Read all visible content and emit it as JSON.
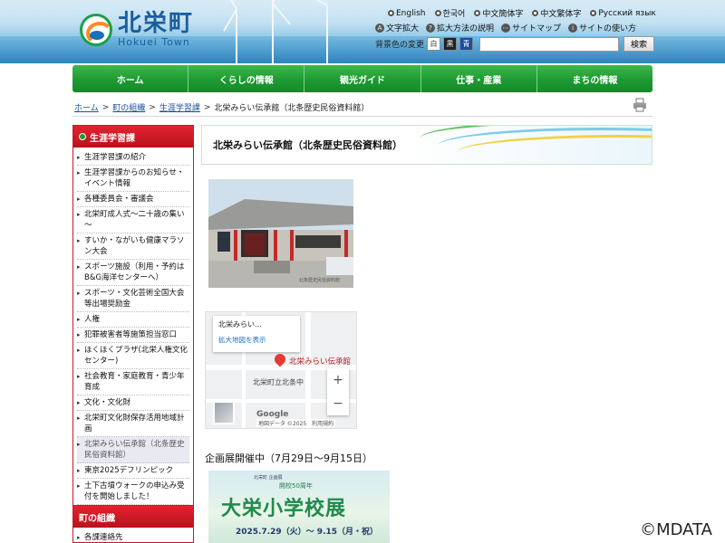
{
  "header": {
    "logo_title": "北栄町",
    "logo_sub": "Hokuei Town",
    "languages": [
      "English",
      "한국어",
      "中文簡体字",
      "中文繁体字",
      "Русский язык"
    ],
    "util": {
      "text_size": "文字拡大",
      "zoom_help": "拡大方法の説明",
      "sitemap": "サイトマップ",
      "usage": "サイトの使い方"
    },
    "bg_color_label": "背景色の変更",
    "bg_options": [
      "白",
      "黒",
      "青"
    ],
    "search_placeholder": "",
    "search_button": "検索"
  },
  "gnav": [
    "ホーム",
    "くらしの情報",
    "観光ガイド",
    "仕事・産業",
    "まちの情報"
  ],
  "breadcrumb": {
    "items": [
      "ホーム",
      "町の組織",
      "生涯学習課"
    ],
    "sep": ">",
    "current": "北栄みらい伝承館（北条歴史民俗資料館）"
  },
  "sidebar": {
    "title": "生涯学習課",
    "items": [
      "生涯学習課の紹介",
      "生涯学習課からのお知らせ・イベント情報",
      "各種委員会・審議会",
      "北栄町成人式～二十歳の集い～",
      "すいか・ながいも健康マラソン大会",
      "スポーツ施設（利用・予約はB&G海洋センターへ）",
      "スポーツ・文化芸術全国大会等出場奨励金",
      "人権",
      "犯罪被害者等施策担当窓口",
      "ほくほくプラザ(北栄人権文化センター)",
      "社会教育・家庭教育・青少年育成",
      "文化・文化財",
      "北栄町文化財保存活用地域計画",
      "北栄みらい伝承館（北条歴史民俗資料館）",
      "東京2025デフリンピック",
      "土下古墳ウォークの申込み受付を開始しました！"
    ],
    "active_index": 13,
    "section2_title": "町の組織",
    "section2_items": [
      "各課連絡先"
    ]
  },
  "main": {
    "page_title": "北栄みらい伝承館（北条歴史民俗資料館）",
    "map": {
      "card_title": "北栄みらい...",
      "card_link": "拡大地図を表示",
      "pin_label": "北栄みらい伝承館",
      "school_label": "北栄町立北条中",
      "zoom_in": "+",
      "zoom_out": "−",
      "footer": "地図データ ©2025　利用規約",
      "logo": "Google"
    },
    "event_heading": "企画展開催中（7月29日～9月15日）",
    "poster": {
      "top": "北栄町 企画展",
      "sub": "開校50周年",
      "title": "大栄小学校展",
      "date": "2025.7.29（火）～ 9.15（月・祝）"
    }
  },
  "watermark": "©MDATA",
  "colors": {
    "nav_green": "#1d9a32",
    "sidebar_red": "#c8162b",
    "link_blue": "#1a4fa0"
  }
}
